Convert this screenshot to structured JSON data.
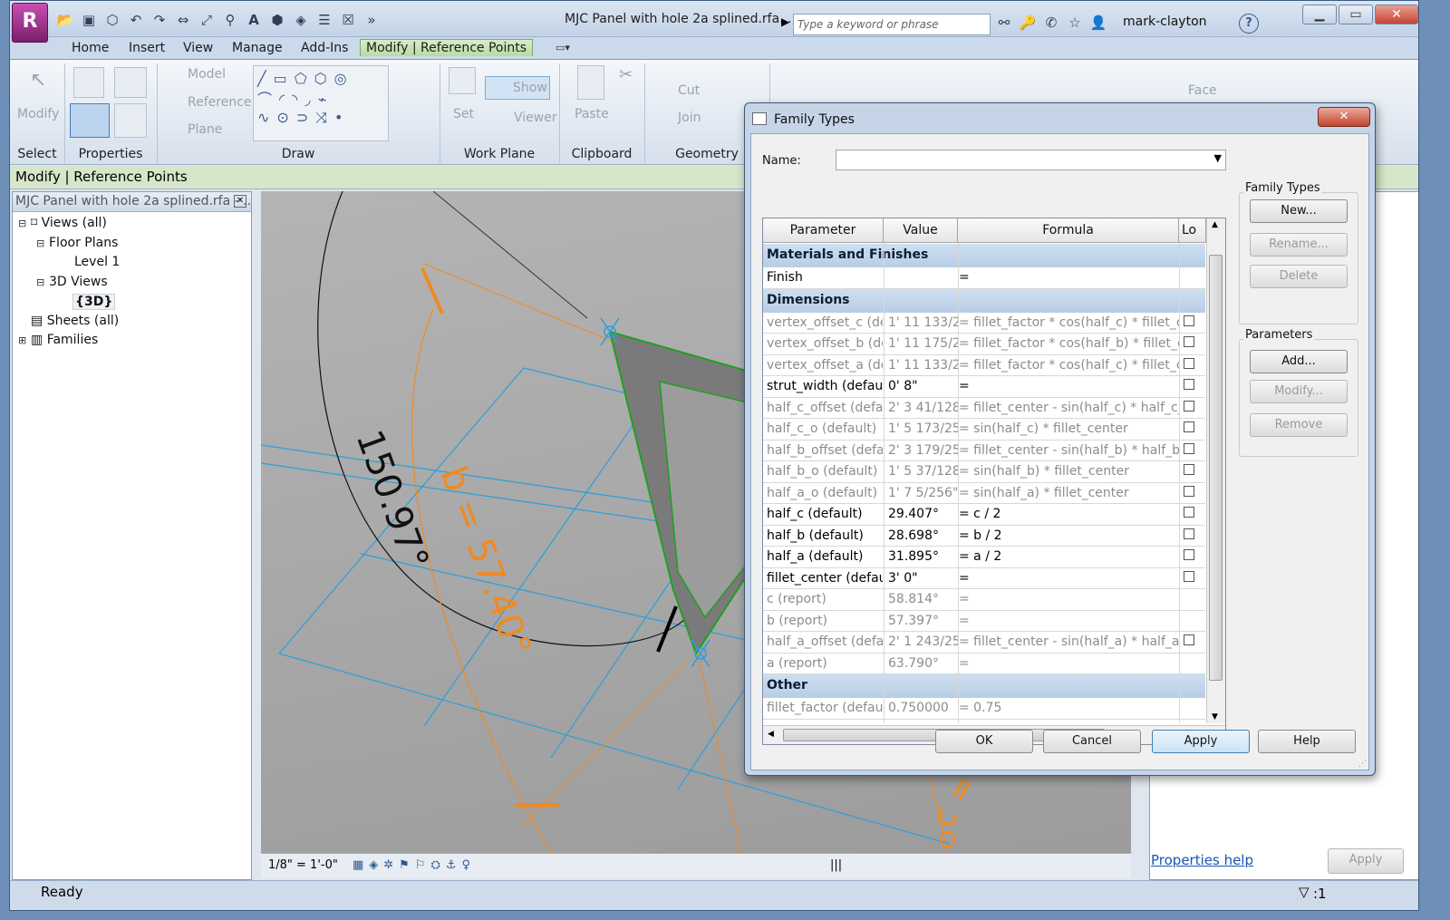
{
  "window": {
    "title": "MJC Panel with hole 2a splined.rfa...",
    "search_placeholder": "Type a keyword or phrase",
    "user": "mark-clayton",
    "app_icon_letter": "R"
  },
  "tabs": [
    "Home",
    "Insert",
    "View",
    "Manage",
    "Add-Ins",
    "Modify | Reference Points"
  ],
  "ribbon": {
    "panels": [
      "Select",
      "Properties",
      "Draw",
      "Work Plane",
      "Clipboard",
      "Geometry"
    ],
    "modify_label": "Modify",
    "work_plane_tools": [
      "Model",
      "Reference",
      "Plane"
    ],
    "set_label": "Set",
    "show_label": "Show",
    "viewer_label": "Viewer",
    "paste_label": "Paste",
    "cut_label": "Cut",
    "join_label": "Join",
    "face_label": "Face"
  },
  "options_bar": "Modify | Reference Points",
  "project_browser": {
    "header": "MJC Panel with hole 2a splined.rfa - ...",
    "items": [
      {
        "label": "Views (all)",
        "level": 0
      },
      {
        "label": "Floor Plans",
        "level": 1
      },
      {
        "label": "Level 1",
        "level": 2
      },
      {
        "label": "3D Views",
        "level": 1
      },
      {
        "label": "{3D}",
        "level": 2
      },
      {
        "label": "Sheets (all)",
        "level": 0
      },
      {
        "label": "Families",
        "level": 0
      }
    ]
  },
  "viewport": {
    "angle_label": "150.97°",
    "b_label": "b = 57.40°",
    "c_label": "c = 58"
  },
  "view_bar": {
    "scale": "1/8\" = 1'-0\""
  },
  "properties_panel": {
    "help_link": "Properties help",
    "apply": "Apply"
  },
  "status": {
    "text": "Ready",
    "filter": ":1"
  },
  "dialog": {
    "title": "Family Types",
    "name_label": "Name:",
    "name_value": "",
    "columns": [
      "Parameter",
      "Value",
      "Formula",
      "Lo"
    ],
    "sections": [
      {
        "title": "Materials and Finishes",
        "rows": [
          {
            "param": "Finish",
            "value": "",
            "formula": "=",
            "gray": false,
            "check": false
          }
        ]
      },
      {
        "title": "Dimensions",
        "rows": [
          {
            "param": "vertex_offset_c (def",
            "value": "1'  11 133/2",
            "formula": "= fillet_factor * cos(half_c) * fillet_cen",
            "gray": true,
            "check": true
          },
          {
            "param": "vertex_offset_b (def",
            "value": "1'  11 175/2",
            "formula": "= fillet_factor * cos(half_b) * fillet_cen",
            "gray": true,
            "check": true
          },
          {
            "param": "vertex_offset_a (def",
            "value": "1'  11 133/2",
            "formula": "= fillet_factor * cos(half_c) * fillet_cen",
            "gray": true,
            "check": true
          },
          {
            "param": "strut_width (default",
            "value": "0'  8\"",
            "formula": "=",
            "gray": false,
            "check": true
          },
          {
            "param": "half_c_offset (defau",
            "value": "2'  3 41/128",
            "formula": "= fillet_center - sin(half_c) * half_c_o",
            "gray": true,
            "check": true
          },
          {
            "param": "half_c_o (default)",
            "value": "1'  5 173/25",
            "formula": "= sin(half_c) * fillet_center",
            "gray": true,
            "check": true
          },
          {
            "param": "half_b_offset (defau",
            "value": "2'  3 179/25",
            "formula": "= fillet_center - sin(half_b) * half_b_o",
            "gray": true,
            "check": true
          },
          {
            "param": "half_b_o (default)",
            "value": "1'  5 37/128",
            "formula": "= sin(half_b) * fillet_center",
            "gray": true,
            "check": true
          },
          {
            "param": "half_a_o (default)",
            "value": "1'  7 5/256\"",
            "formula": "= sin(half_a) * fillet_center",
            "gray": true,
            "check": true
          },
          {
            "param": "half_c (default)",
            "value": "29.407°",
            "formula": "= c / 2",
            "gray": false,
            "check": true
          },
          {
            "param": "half_b (default)",
            "value": "28.698°",
            "formula": "= b / 2",
            "gray": false,
            "check": true
          },
          {
            "param": "half_a (default)",
            "value": "31.895°",
            "formula": "= a / 2",
            "gray": false,
            "check": true
          },
          {
            "param": "fillet_center (defaul",
            "value": "3'  0\"",
            "formula": "=",
            "gray": false,
            "check": true
          },
          {
            "param": "c (report)",
            "value": "58.814°",
            "formula": "=",
            "gray": true,
            "check": false
          },
          {
            "param": "b (report)",
            "value": "57.397°",
            "formula": "=",
            "gray": true,
            "check": false
          },
          {
            "param": "half_a_offset (defau",
            "value": "2'  1 243/25",
            "formula": "= fillet_center - sin(half_a) * half_a_o",
            "gray": true,
            "check": true
          },
          {
            "param": "a (report)",
            "value": "63.790°",
            "formula": "=",
            "gray": true,
            "check": false
          }
        ]
      },
      {
        "title": "Other",
        "rows": [
          {
            "param": "fillet_factor (default",
            "value": "0.750000",
            "formula": "= 0.75",
            "gray": true,
            "check": false
          }
        ]
      }
    ],
    "family_types_group": "Family Types",
    "family_types_buttons": [
      "New...",
      "Rename...",
      "Delete"
    ],
    "parameters_group": "Parameters",
    "parameters_buttons": [
      "Add...",
      "Modify...",
      "Remove"
    ],
    "footer_buttons": [
      "OK",
      "Cancel",
      "Apply",
      "Help"
    ]
  }
}
